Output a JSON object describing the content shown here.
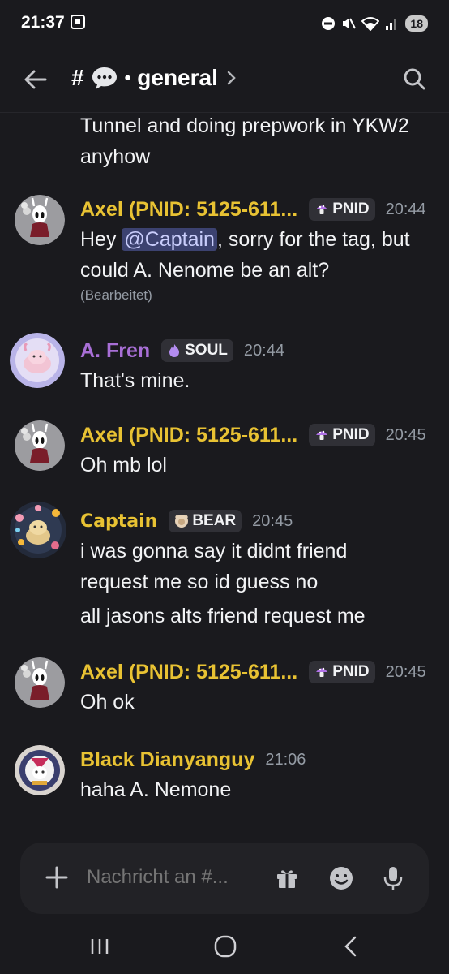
{
  "status_bar": {
    "time": "21:37",
    "battery": "18"
  },
  "header": {
    "hash": "#",
    "dot": "•",
    "channel_name": "general"
  },
  "messages": {
    "continuation": [
      "Tunnel and doing prepwork in YKW2",
      "anyhow"
    ],
    "m1": {
      "author": "Axel (PNID: 5125-611...",
      "tag": "PNID",
      "time": "20:44",
      "pre": "Hey ",
      "mention": "@Captain",
      "post": ", sorry for the tag, but",
      "line2": "could A. Nenome be an alt?",
      "edited": "(Bearbeitet)"
    },
    "m2": {
      "author": "A. Fren",
      "tag": "SOUL",
      "time": "20:44",
      "line1": "That's mine."
    },
    "m3": {
      "author": "Axel (PNID: 5125-611...",
      "tag": "PNID",
      "time": "20:45",
      "line1": "Oh mb lol"
    },
    "m4": {
      "author": "Captain",
      "tag": "BEAR",
      "time": "20:45",
      "line1": "i was gonna say it didnt friend",
      "line2": "request me so id guess no",
      "line3": "all jasons alts friend request me"
    },
    "m5": {
      "author": "Axel (PNID: 5125-611...",
      "tag": "PNID",
      "time": "20:45",
      "line1": "Oh ok"
    },
    "m6": {
      "author": "Black Dianyanguy",
      "time": "21:06",
      "line1": "haha A. Nemone"
    }
  },
  "composer": {
    "placeholder": "Nachricht an #..."
  },
  "colors": {
    "background": "#1a1a1e",
    "username_yellow": "#e8c233",
    "username_purple": "#a86fd6",
    "mention_bg": "#3c4270"
  },
  "icons": [
    "back-arrow-icon",
    "hash-icon",
    "speech-bubble-icon",
    "chevron-right-icon",
    "search-icon",
    "plus-icon",
    "gift-icon",
    "emoji-icon",
    "microphone-icon",
    "recents-icon",
    "home-icon",
    "back-nav-icon"
  ]
}
